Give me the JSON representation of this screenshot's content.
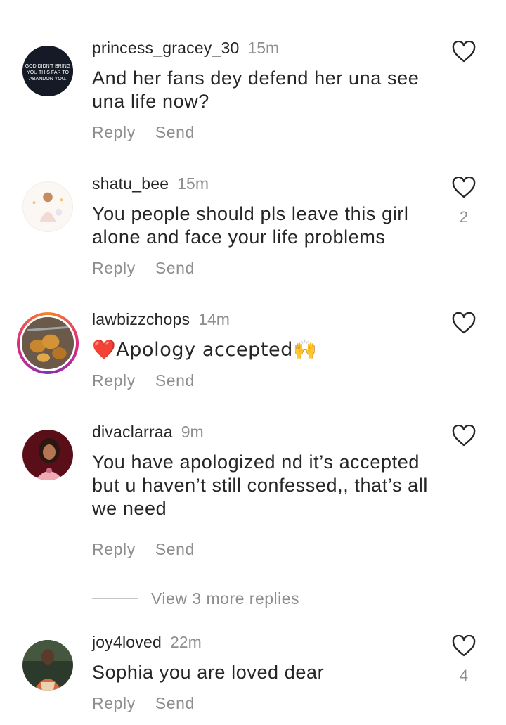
{
  "comments": [
    {
      "username": "princess_gracey_30",
      "time": "15m",
      "text": "And her fans dey defend her una see una life now?",
      "reply": "Reply",
      "send": "Send",
      "likes": "",
      "avatar_text": "GOD DIDN'T BRING YOU THIS FAR TO ABANDON YOU."
    },
    {
      "username": "shatu_bee",
      "time": "15m",
      "text": "You people should pls leave this girl alone and face your life problems",
      "reply": "Reply",
      "send": "Send",
      "likes": "2"
    },
    {
      "username": "lawbizzchops",
      "time": "14m",
      "text": "❤️Apology accepted🙌",
      "reply": "Reply",
      "send": "Send",
      "likes": ""
    },
    {
      "username": "divaclarraa",
      "time": "9m",
      "text": "You have apologized nd it’s accepted but u haven’t still confessed,, that’s all we need",
      "reply": "Reply",
      "send": "Send",
      "likes": ""
    },
    {
      "username": "joy4loved",
      "time": "22m",
      "text": "Sophia you are loved dear",
      "reply": "Reply",
      "send": "Send",
      "likes": "4"
    }
  ],
  "view_more_replies": "View 3 more replies",
  "colors": {
    "text": "#262626",
    "secondary": "#8e8e8e",
    "story_ring": "#dd2a7b"
  },
  "icons": {
    "like": "heart-outline-icon"
  }
}
